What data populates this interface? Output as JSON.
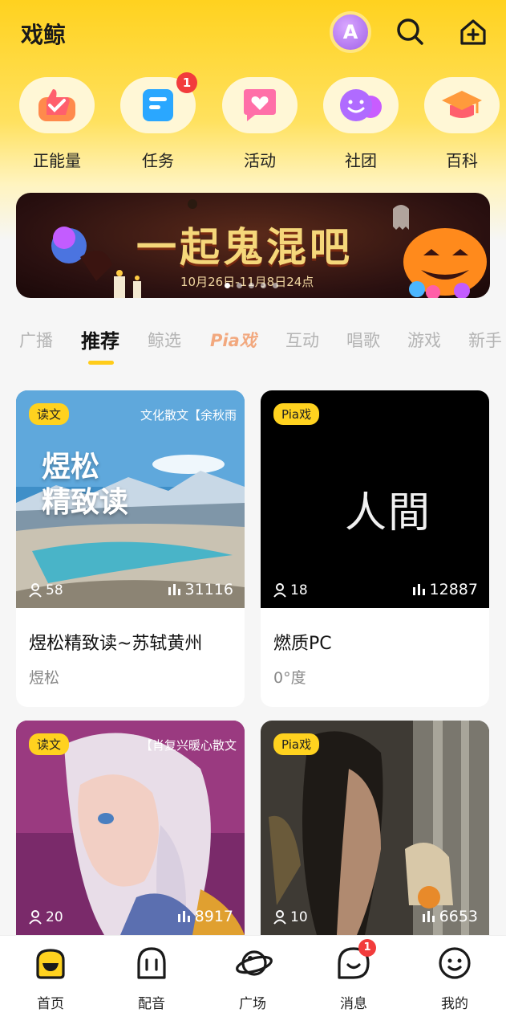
{
  "header": {
    "title": "戏鲸",
    "avatar_letter": "A"
  },
  "quick_actions": [
    {
      "label": "正能量",
      "icon": "thumbs-up-icon"
    },
    {
      "label": "任务",
      "icon": "task-icon",
      "badge": "1"
    },
    {
      "label": "活动",
      "icon": "heart-chat-icon"
    },
    {
      "label": "社团",
      "icon": "smile-bubble-icon"
    },
    {
      "label": "百科",
      "icon": "graduation-cap-icon"
    }
  ],
  "banner": {
    "title": "一起鬼混吧",
    "date": "10月26日-11月8日24点"
  },
  "tabs": [
    "广播",
    "推荐",
    "鲸选",
    "Pia戏",
    "互动",
    "唱歌",
    "游戏",
    "新手"
  ],
  "active_tab": "推荐",
  "cards": [
    {
      "tag": "读文",
      "subtitle": "文化散文【余秋雨",
      "overlay": "煜松\n精致读",
      "listeners": "58",
      "plays": "31116",
      "title": "煜松精致读~苏轼黄州",
      "author": "煜松"
    },
    {
      "tag": "Pia戏",
      "subtitle": "",
      "overlay": "人間",
      "listeners": "18",
      "plays": "12887",
      "title": "燃质PC",
      "author": "0°度"
    },
    {
      "tag": "读文",
      "subtitle": "【肖复兴暖心散文",
      "overlay": "",
      "listeners": "20",
      "plays": "8917"
    },
    {
      "tag": "Pia戏",
      "subtitle": "",
      "overlay": "",
      "listeners": "10",
      "plays": "6653"
    }
  ],
  "bottom_nav": [
    {
      "label": "首页",
      "icon": "home-icon"
    },
    {
      "label": "配音",
      "icon": "dubbing-icon"
    },
    {
      "label": "广场",
      "icon": "planet-icon"
    },
    {
      "label": "消息",
      "icon": "message-icon",
      "badge": "1"
    },
    {
      "label": "我的",
      "icon": "profile-icon"
    }
  ],
  "colors": {
    "brand_yellow": "#ffd21f",
    "badge_red": "#f23c3c"
  }
}
